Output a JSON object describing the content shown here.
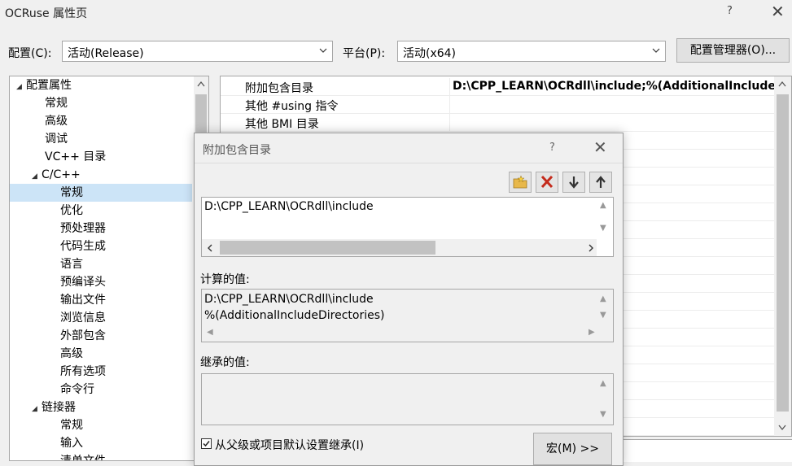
{
  "window": {
    "title": "OCRuse 属性页",
    "help": "?",
    "close": "✕"
  },
  "config": {
    "config_label": "配置(C):",
    "config_value": "活动(Release)",
    "platform_label": "平台(P):",
    "platform_value": "活动(x64)",
    "manager_button": "配置管理器(O)..."
  },
  "tree": {
    "items": [
      {
        "label": "配置属性"
      },
      {
        "label": "常规"
      },
      {
        "label": "高级"
      },
      {
        "label": "调试"
      },
      {
        "label": "VC++ 目录"
      },
      {
        "label": "C/C++"
      },
      {
        "label": "常规"
      },
      {
        "label": "优化"
      },
      {
        "label": "预处理器"
      },
      {
        "label": "代码生成"
      },
      {
        "label": "语言"
      },
      {
        "label": "预编译头"
      },
      {
        "label": "输出文件"
      },
      {
        "label": "浏览信息"
      },
      {
        "label": "外部包含"
      },
      {
        "label": "高级"
      },
      {
        "label": "所有选项"
      },
      {
        "label": "命令行"
      },
      {
        "label": "链接器"
      },
      {
        "label": "常规"
      },
      {
        "label": "输入"
      },
      {
        "label": "清单文件"
      }
    ]
  },
  "grid": {
    "rows": [
      {
        "name": "附加包含目录",
        "value": "D:\\CPP_LEARN\\OCRdll\\include;%(AdditionalIncludeDirectories)"
      },
      {
        "name": "其他 #using 指令",
        "value": ""
      },
      {
        "name": "其他 BMI 目录",
        "value": ""
      }
    ]
  },
  "dialog": {
    "title": "附加包含目录",
    "help": "?",
    "close": "✕",
    "tools": [
      "new-folder",
      "delete",
      "move-down",
      "move-up"
    ],
    "entries": [
      "D:\\CPP_LEARN\\OCRdll\\include"
    ],
    "computed_label": "计算的值:",
    "computed_lines": [
      "D:\\CPP_LEARN\\OCRdll\\include",
      "%(AdditionalIncludeDirectories)"
    ],
    "inherited_label": "继承的值:",
    "inherit_checkbox": "从父级或项目默认设置继承(I)",
    "macro_button": "宏(M) >>"
  },
  "colors": {
    "selection": "#cce4f7",
    "delete_red": "#c42b1c",
    "folder_yellow": "#e8b84a"
  }
}
